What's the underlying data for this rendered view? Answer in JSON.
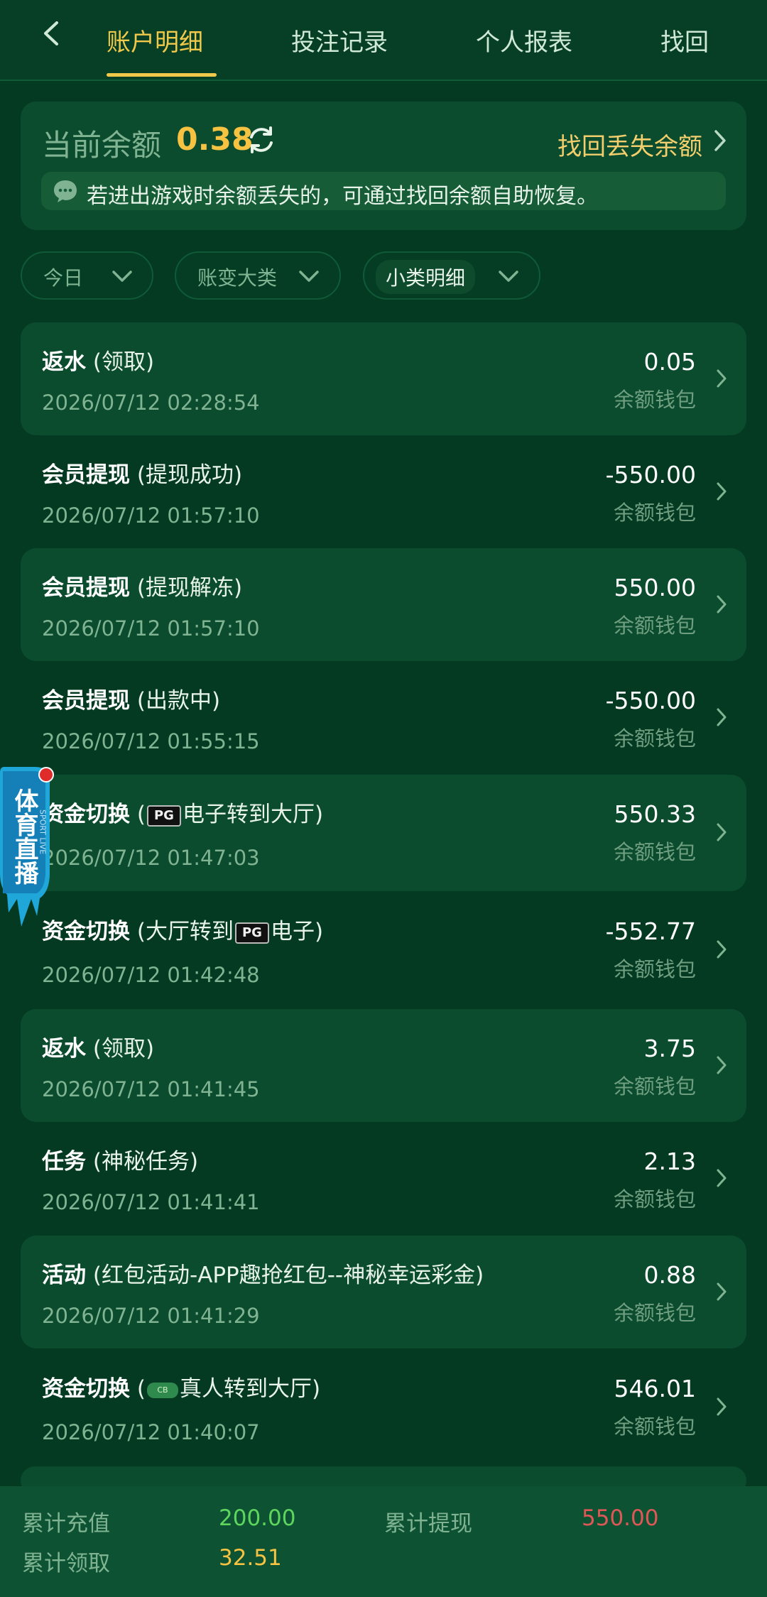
{
  "tabs": [
    "账户明细",
    "投注记录",
    "个人报表",
    "找回"
  ],
  "balance": {
    "label": "当前余额",
    "value": "0.38",
    "recover_label": "找回丢失余额",
    "notice": "若进出游戏时余额丢失的，可通过找回余额自助恢复。"
  },
  "filters": {
    "period": "今日",
    "major_category": "账变大类",
    "minor_category": "小类明细"
  },
  "records": [
    {
      "title": "返水",
      "sub_prefix": "(领取)",
      "logo": "",
      "sub_suffix": "",
      "time": "2026/07/12 02:28:54",
      "amount": "0.05",
      "wallet": "余额钱包"
    },
    {
      "title": "会员提现",
      "sub_prefix": "(提现成功)",
      "logo": "",
      "sub_suffix": "",
      "time": "2026/07/12 01:57:10",
      "amount": "-550.00",
      "wallet": "余额钱包"
    },
    {
      "title": "会员提现",
      "sub_prefix": "(提现解冻)",
      "logo": "",
      "sub_suffix": "",
      "time": "2026/07/12 01:57:10",
      "amount": "550.00",
      "wallet": "余额钱包"
    },
    {
      "title": "会员提现",
      "sub_prefix": "(出款中)",
      "logo": "",
      "sub_suffix": "",
      "time": "2026/07/12 01:55:15",
      "amount": "-550.00",
      "wallet": "余额钱包"
    },
    {
      "title": "资金切换",
      "sub_prefix": "(",
      "logo": "PG",
      "sub_suffix": "电子转到大厅)",
      "time": "2026/07/12 01:47:03",
      "amount": "550.33",
      "wallet": "余额钱包"
    },
    {
      "title": "资金切换",
      "sub_prefix": "(大厅转到",
      "logo": "PG",
      "sub_suffix": "电子)",
      "time": "2026/07/12 01:42:48",
      "amount": "-552.77",
      "wallet": "余额钱包"
    },
    {
      "title": "返水",
      "sub_prefix": "(领取)",
      "logo": "",
      "sub_suffix": "",
      "time": "2026/07/12 01:41:45",
      "amount": "3.75",
      "wallet": "余额钱包"
    },
    {
      "title": "任务",
      "sub_prefix": "(神秘任务)",
      "logo": "",
      "sub_suffix": "",
      "time": "2026/07/12 01:41:41",
      "amount": "2.13",
      "wallet": "余额钱包"
    },
    {
      "title": "活动",
      "sub_prefix": "(红包活动-APP趣抢红包--神秘幸运彩金)",
      "logo": "",
      "sub_suffix": "",
      "time": "2026/07/12 01:41:29",
      "amount": "0.88",
      "wallet": "余额钱包"
    },
    {
      "title": "资金切换",
      "sub_prefix": "(",
      "logo": "CB",
      "sub_suffix": "真人转到大厅)",
      "time": "2026/07/12 01:40:07",
      "amount": "546.01",
      "wallet": "余额钱包"
    }
  ],
  "sport_live": {
    "label": "体育直播",
    "sub": "SPORT LIVE"
  },
  "summary": {
    "recharge_label": "累计充值",
    "recharge_value": "200.00",
    "withdraw_label": "累计提现",
    "withdraw_value": "550.00",
    "claim_label": "累计领取",
    "claim_value": "32.51"
  },
  "colors": {
    "accent": "#f0c84a",
    "positive": "#5ed65e",
    "negative": "#e05757",
    "gold": "#f5c242",
    "background": "#043a22"
  }
}
